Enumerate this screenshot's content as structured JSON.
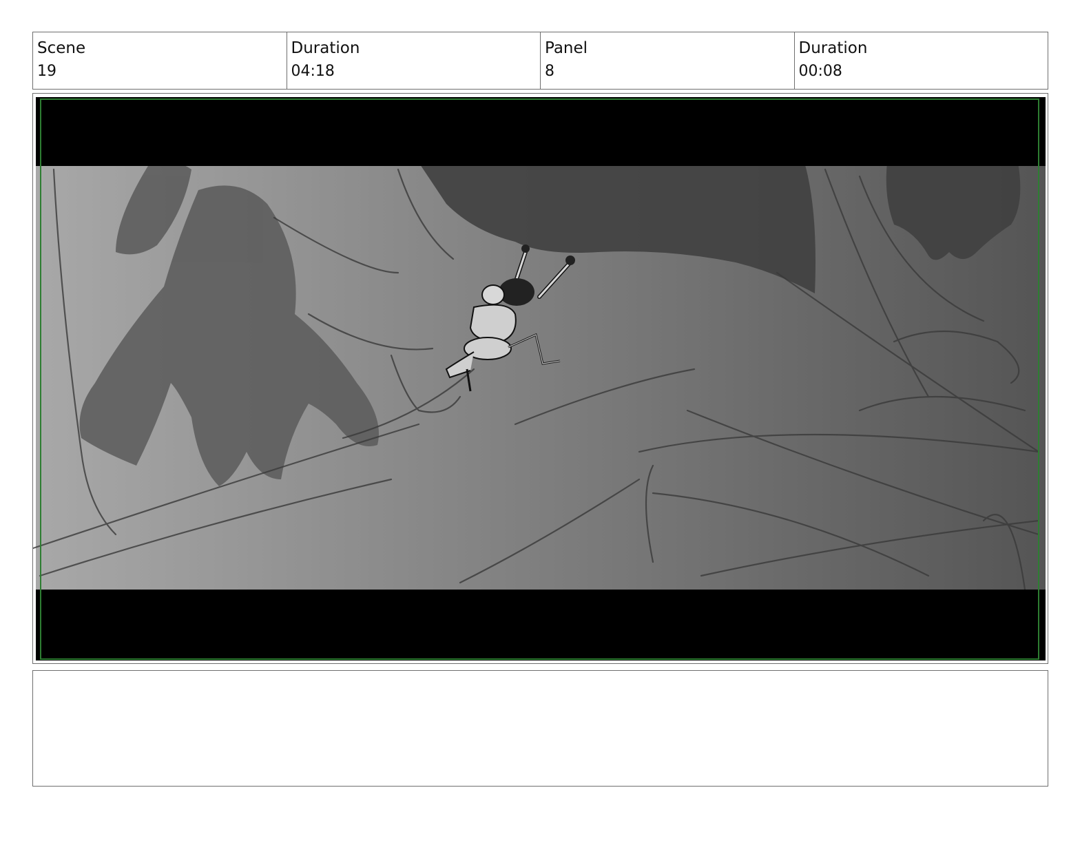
{
  "header": {
    "scene_label": "Scene",
    "scene_value": "19",
    "scene_duration_label": "Duration",
    "scene_duration_value": "04:18",
    "panel_label": "Panel",
    "panel_value": "8",
    "panel_duration_label": "Duration",
    "panel_duration_value": "00:08"
  },
  "panel": {
    "icon": "storyboard-sketch-image",
    "colors": {
      "letterbox": "#000000",
      "safe_frame": "#2e7d32",
      "background_light": "#a8a8a8",
      "background_dark": "#555555"
    }
  },
  "notes": {
    "text": ""
  }
}
